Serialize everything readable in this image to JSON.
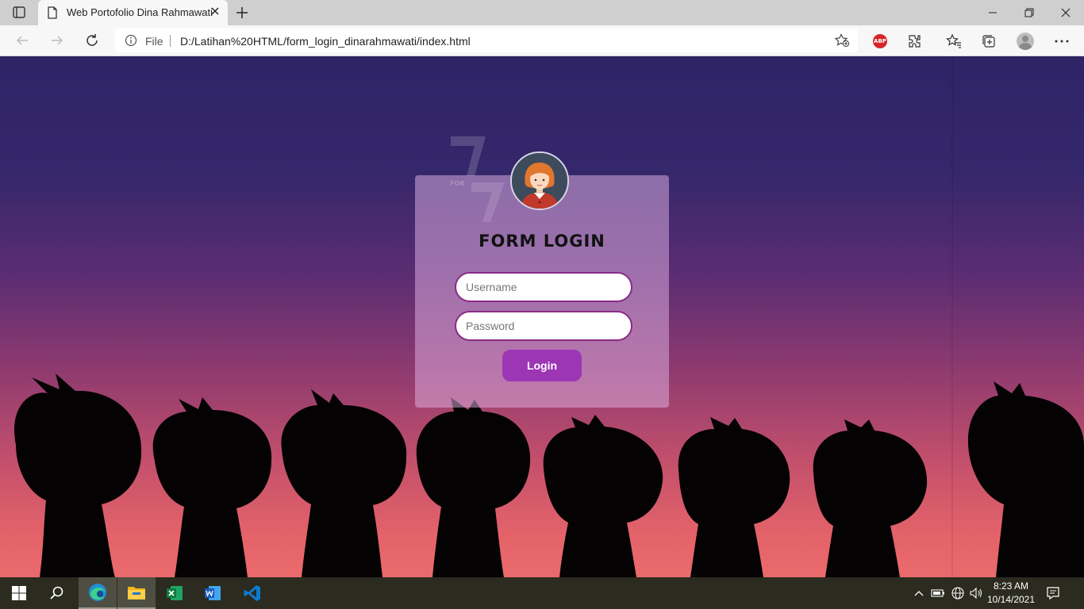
{
  "browser": {
    "tab_title": "Web Portofolio Dina Rahmawati",
    "address_scheme": "File",
    "address_url": "D:/Latihan%20HTML/form_login_dinarahmawati/index.html",
    "extension_badge": "ABP"
  },
  "page": {
    "form_title": "FORM LOGIN",
    "username_placeholder": "Username",
    "password_placeholder": "Password",
    "login_label": "Login",
    "logo_text": "FOR",
    "colors": {
      "card": "#e2b4e6",
      "field_border": "#8a2a85",
      "button": "#9c36b5"
    }
  },
  "taskbar": {
    "time": "8:23 AM",
    "date": "10/14/2021",
    "apps": [
      "start-icon",
      "search-icon",
      "edge-icon",
      "file-explorer-icon",
      "excel-icon",
      "word-icon",
      "vscode-icon"
    ]
  }
}
